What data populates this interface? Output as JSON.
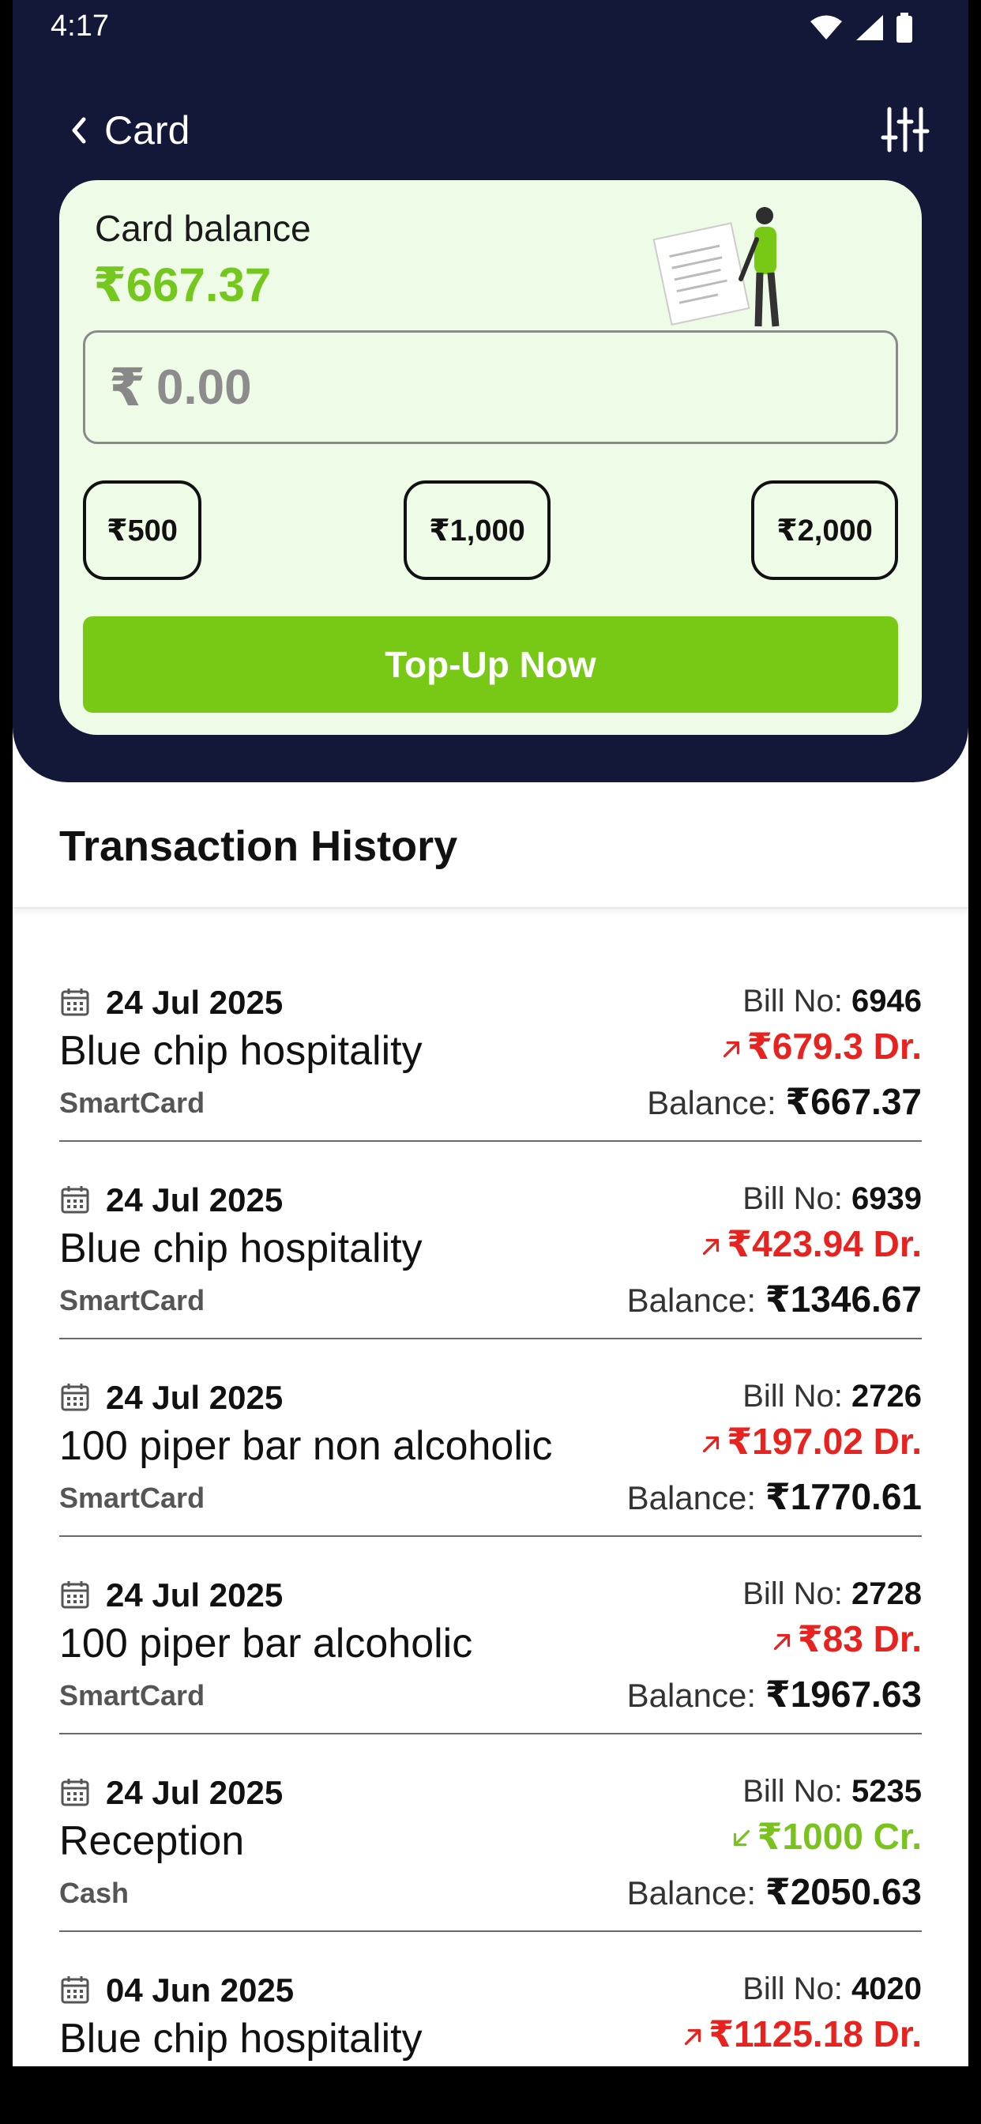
{
  "status_bar": {
    "time": "4:17"
  },
  "nav": {
    "back_label": "Card"
  },
  "card": {
    "balance_label": "Card balance",
    "balance_value": "₹667.37",
    "amount_prefix": "₹",
    "amount_value": "0.00",
    "quick_amounts": [
      "₹500",
      "₹1,000",
      "₹2,000"
    ],
    "topup_label": "Top-Up Now"
  },
  "transactions_section": {
    "title": "Transaction History"
  },
  "transactions": [
    {
      "date": "24 Jul 2025",
      "bill_label": "Bill No:",
      "bill_no": "6946",
      "merchant": "Blue chip hospitality",
      "amount": "₹679.3 Dr.",
      "direction": "Dr",
      "method": "SmartCard",
      "balance_label": "Balance:",
      "balance": "₹667.37"
    },
    {
      "date": "24 Jul 2025",
      "bill_label": "Bill No:",
      "bill_no": "6939",
      "merchant": "Blue chip hospitality",
      "amount": "₹423.94 Dr.",
      "direction": "Dr",
      "method": "SmartCard",
      "balance_label": "Balance:",
      "balance": "₹1346.67"
    },
    {
      "date": "24 Jul 2025",
      "bill_label": "Bill No:",
      "bill_no": "2726",
      "merchant": "100 piper bar  non alcoholic",
      "amount": "₹197.02 Dr.",
      "direction": "Dr",
      "method": "SmartCard",
      "balance_label": "Balance:",
      "balance": "₹1770.61"
    },
    {
      "date": "24 Jul 2025",
      "bill_label": "Bill No:",
      "bill_no": "2728",
      "merchant": "100 piper bar alcoholic",
      "amount": "₹83 Dr.",
      "direction": "Dr",
      "method": "SmartCard",
      "balance_label": "Balance:",
      "balance": "₹1967.63"
    },
    {
      "date": "24 Jul 2025",
      "bill_label": "Bill No:",
      "bill_no": "5235",
      "merchant": "Reception",
      "amount": "₹1000 Cr.",
      "direction": "Cr",
      "method": "Cash",
      "balance_label": "Balance:",
      "balance": "₹2050.63"
    },
    {
      "date": "04 Jun 2025",
      "bill_label": "Bill No:",
      "bill_no": "4020",
      "merchant": "Blue chip hospitality",
      "amount": "₹1125.18 Dr.",
      "direction": "Dr",
      "method": "",
      "balance_label": "",
      "balance": ""
    }
  ],
  "colors": {
    "header_bg": "#141838",
    "card_bg": "#eefbe6",
    "accent_green": "#78c916",
    "debit_red": "#e8231f",
    "credit_green": "#7ac31f"
  },
  "icons": {
    "back": "chevron-left-icon",
    "filter": "sliders-icon",
    "calendar": "calendar-icon",
    "debit": "arrow-up-right-icon",
    "credit": "arrow-down-left-icon"
  }
}
